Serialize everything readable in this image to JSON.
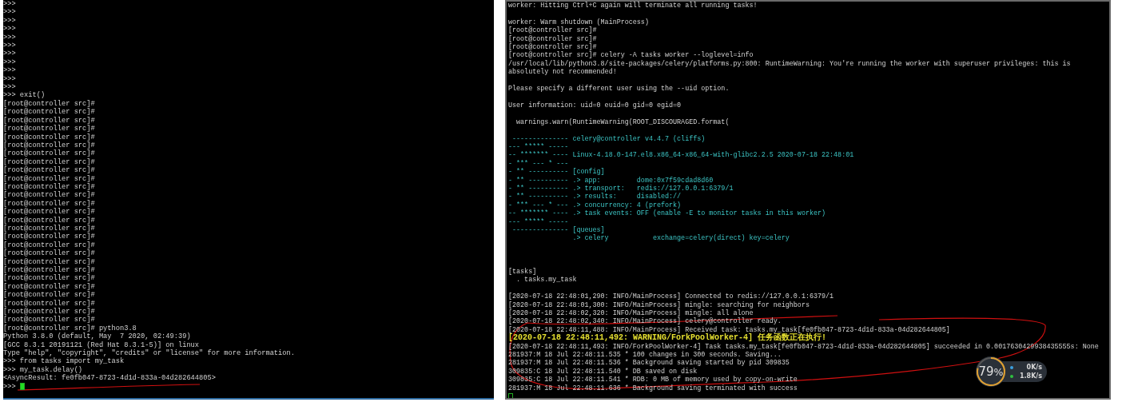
{
  "left_terminal": {
    "lines": [
      {
        "kind": "text",
        "text": ">>>"
      },
      {
        "kind": "text",
        "text": ">>>"
      },
      {
        "kind": "text",
        "text": ">>>"
      },
      {
        "kind": "text",
        "text": ">>>"
      },
      {
        "kind": "text",
        "text": ">>>"
      },
      {
        "kind": "text",
        "text": ">>>"
      },
      {
        "kind": "text",
        "text": ">>>"
      },
      {
        "kind": "text",
        "text": ">>>"
      },
      {
        "kind": "text",
        "text": ">>>"
      },
      {
        "kind": "text",
        "text": ">>>"
      },
      {
        "kind": "text",
        "text": ">>>"
      },
      {
        "kind": "text",
        "text": ">>> exit()"
      },
      {
        "kind": "text",
        "text": "[root@controller src]#"
      },
      {
        "kind": "text",
        "text": "[root@controller src]#"
      },
      {
        "kind": "text",
        "text": "[root@controller src]#"
      },
      {
        "kind": "text",
        "text": "[root@controller src]#"
      },
      {
        "kind": "text",
        "text": "[root@controller src]#"
      },
      {
        "kind": "text",
        "text": "[root@controller src]#"
      },
      {
        "kind": "text",
        "text": "[root@controller src]#"
      },
      {
        "kind": "text",
        "text": "[root@controller src]#"
      },
      {
        "kind": "text",
        "text": "[root@controller src]#"
      },
      {
        "kind": "text",
        "text": "[root@controller src]#"
      },
      {
        "kind": "text",
        "text": "[root@controller src]#"
      },
      {
        "kind": "text",
        "text": "[root@controller src]#"
      },
      {
        "kind": "text",
        "text": "[root@controller src]#"
      },
      {
        "kind": "text",
        "text": "[root@controller src]#"
      },
      {
        "kind": "text",
        "text": "[root@controller src]#"
      },
      {
        "kind": "text",
        "text": "[root@controller src]#"
      },
      {
        "kind": "text",
        "text": "[root@controller src]#"
      },
      {
        "kind": "text",
        "text": "[root@controller src]#"
      },
      {
        "kind": "text",
        "text": "[root@controller src]#"
      },
      {
        "kind": "text",
        "text": "[root@controller src]#"
      },
      {
        "kind": "text",
        "text": "[root@controller src]#"
      },
      {
        "kind": "text",
        "text": "[root@controller src]#"
      },
      {
        "kind": "text",
        "text": "[root@controller src]#"
      },
      {
        "kind": "text",
        "text": "[root@controller src]#"
      },
      {
        "kind": "text",
        "text": "[root@controller src]#"
      },
      {
        "kind": "text",
        "text": "[root@controller src]#"
      },
      {
        "kind": "text",
        "text": "[root@controller src]#"
      },
      {
        "kind": "text",
        "text": "[root@controller src]# python3.8"
      },
      {
        "kind": "text",
        "text": "Python 3.8.0 (default, May  7 2020, 02:49:39)"
      },
      {
        "kind": "text",
        "text": "[GCC 8.3.1 20191121 (Red Hat 8.3.1-5)] on linux"
      },
      {
        "kind": "text",
        "text": "Type \"help\", \"copyright\", \"credits\" or \"license\" for more information."
      },
      {
        "kind": "text",
        "text": ">>> from tasks import my_task"
      },
      {
        "kind": "text",
        "text": ">>> my_task.delay()"
      },
      {
        "kind": "text",
        "text": "<AsyncResult: fe0fb047-8723-4d1d-833a-04d282644805>"
      },
      {
        "kind": "cursor",
        "text": ">>>"
      }
    ]
  },
  "right_terminal": {
    "lines": [
      {
        "kind": "text",
        "text": "worker: Hitting Ctrl+C again will terminate all running tasks!"
      },
      {
        "kind": "blank"
      },
      {
        "kind": "text",
        "text": "worker: Warm shutdown (MainProcess)"
      },
      {
        "kind": "text",
        "text": "[root@controller src]#"
      },
      {
        "kind": "text",
        "text": "[root@controller src]#"
      },
      {
        "kind": "text",
        "text": "[root@controller src]#"
      },
      {
        "kind": "text",
        "text": "[root@controller src]# celery -A tasks worker --loglevel=info"
      },
      {
        "kind": "text",
        "text": "/usr/local/lib/python3.8/site-packages/celery/platforms.py:800: RuntimeWarning: You're running the worker with superuser privileges: this is"
      },
      {
        "kind": "text",
        "text": "absolutely not recommended!"
      },
      {
        "kind": "blank"
      },
      {
        "kind": "text",
        "text": "Please specify a different user using the --uid option."
      },
      {
        "kind": "blank"
      },
      {
        "kind": "text",
        "text": "User information: uid=0 euid=0 gid=0 egid=0"
      },
      {
        "kind": "blank"
      },
      {
        "kind": "text",
        "text": "  warnings.warn(RuntimeWarning(ROOT_DISCOURAGED.format("
      },
      {
        "kind": "blank"
      },
      {
        "kind": "banner",
        "text": " -------------- celery@controller v4.4.7 (cliffs)"
      },
      {
        "kind": "banner",
        "text": "--- ***** -----"
      },
      {
        "kind": "banner",
        "text": "-- ******* ---- Linux-4.18.0-147.el8.x86_64-x86_64-with-glibc2.2.5 2020-07-18 22:48:01"
      },
      {
        "kind": "banner",
        "text": "- *** --- * ---"
      },
      {
        "kind": "banner",
        "text": "- ** ---------- [config]"
      },
      {
        "kind": "banner",
        "text": "- ** ---------- .> app:         dome:0x7f59cdad8d60"
      },
      {
        "kind": "banner",
        "text": "- ** ---------- .> transport:   redis://127.0.0.1:6379/1"
      },
      {
        "kind": "banner",
        "text": "- ** ---------- .> results:     disabled://"
      },
      {
        "kind": "banner",
        "text": "- *** --- * --- .> concurrency: 4 (prefork)"
      },
      {
        "kind": "banner",
        "text": "-- ******* ---- .> task events: OFF (enable -E to monitor tasks in this worker)"
      },
      {
        "kind": "banner",
        "text": "--- ***** -----"
      },
      {
        "kind": "banner",
        "text": " -------------- [queues]"
      },
      {
        "kind": "banner",
        "text": "                .> celery           exchange=celery(direct) key=celery"
      },
      {
        "kind": "blank"
      },
      {
        "kind": "blank"
      },
      {
        "kind": "blank"
      },
      {
        "kind": "text",
        "text": "[tasks]"
      },
      {
        "kind": "text",
        "text": "  . tasks.my_task"
      },
      {
        "kind": "blank"
      },
      {
        "kind": "text",
        "text": "[2020-07-18 22:48:01,290: INFO/MainProcess] Connected to redis://127.0.0.1:6379/1"
      },
      {
        "kind": "text",
        "text": "[2020-07-18 22:48:01,300: INFO/MainProcess] mingle: searching for neighbors"
      },
      {
        "kind": "text",
        "text": "[2020-07-18 22:48:02,320: INFO/MainProcess] mingle: all alone"
      },
      {
        "kind": "text",
        "text": "[2020-07-18 22:48:02,340: INFO/MainProcess] celery@controller ready."
      },
      {
        "kind": "text",
        "text": "[2020-07-18 22:48:11,488: INFO/MainProcess] Received task: tasks.my_task[fe0fb047-8723-4d1d-833a-04d282644805]"
      },
      {
        "kind": "warning",
        "text": "[2020-07-18 22:48:11,492: WARNING/ForkPoolWorker-4] 任务函数正在执行!"
      },
      {
        "kind": "text",
        "text": "[2020-07-18 22:48:11,493: INFO/ForkPoolWorker-4] Task tasks.my_task[fe0fb047-8723-4d1d-833a-04d282644805] succeeded in 0.0017630429938435555s: None"
      },
      {
        "kind": "text",
        "text": "281937:M 18 Jul 22:48:11.535 * 100 changes in 300 seconds. Saving..."
      },
      {
        "kind": "text",
        "text": "281937:M 18 Jul 22:48:11.536 * Background saving started by pid 309835"
      },
      {
        "kind": "text",
        "text": "309835:C 18 Jul 22:48:11.540 * DB saved on disk"
      },
      {
        "kind": "text",
        "text": "309835:C 18 Jul 22:48:11.541 * RDB: 0 MB of memory used by copy-on-write"
      },
      {
        "kind": "text",
        "text": "281937:M 18 Jul 22:48:11.636 * Background saving terminated with success"
      },
      {
        "kind": "cursor"
      }
    ]
  },
  "net_monitor": {
    "percent": "79",
    "percent_unit": "%",
    "level": 0.79,
    "rates": [
      {
        "value": "0",
        "unit": "K/s",
        "color": "#3aa0e0"
      },
      {
        "value": "1.8",
        "unit": "K/s",
        "color": "#30c040"
      }
    ]
  }
}
